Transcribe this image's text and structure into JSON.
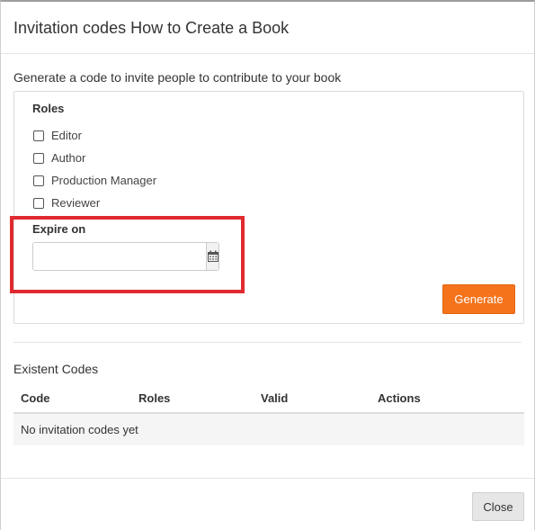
{
  "dialog": {
    "title": "Invitation codes How to Create a Book"
  },
  "generate_section": {
    "intro_text": "Generate a code to invite people to contribute to your book",
    "roles_label": "Roles",
    "roles": [
      {
        "label": "Editor",
        "checked": false
      },
      {
        "label": "Author",
        "checked": false
      },
      {
        "label": "Production Manager",
        "checked": false
      },
      {
        "label": "Reviewer",
        "checked": false
      }
    ],
    "expire_label": "Expire on",
    "expire_value": "",
    "calendar_icon": "calendar-icon",
    "generate_label": "Generate",
    "accent_color": "#f4731b",
    "highlight_color": "#e02a2f"
  },
  "existent_codes": {
    "label": "Existent Codes",
    "columns": [
      "Code",
      "Roles",
      "Valid",
      "Actions"
    ],
    "empty_text": "No invitation codes yet"
  },
  "footer": {
    "close_label": "Close"
  }
}
